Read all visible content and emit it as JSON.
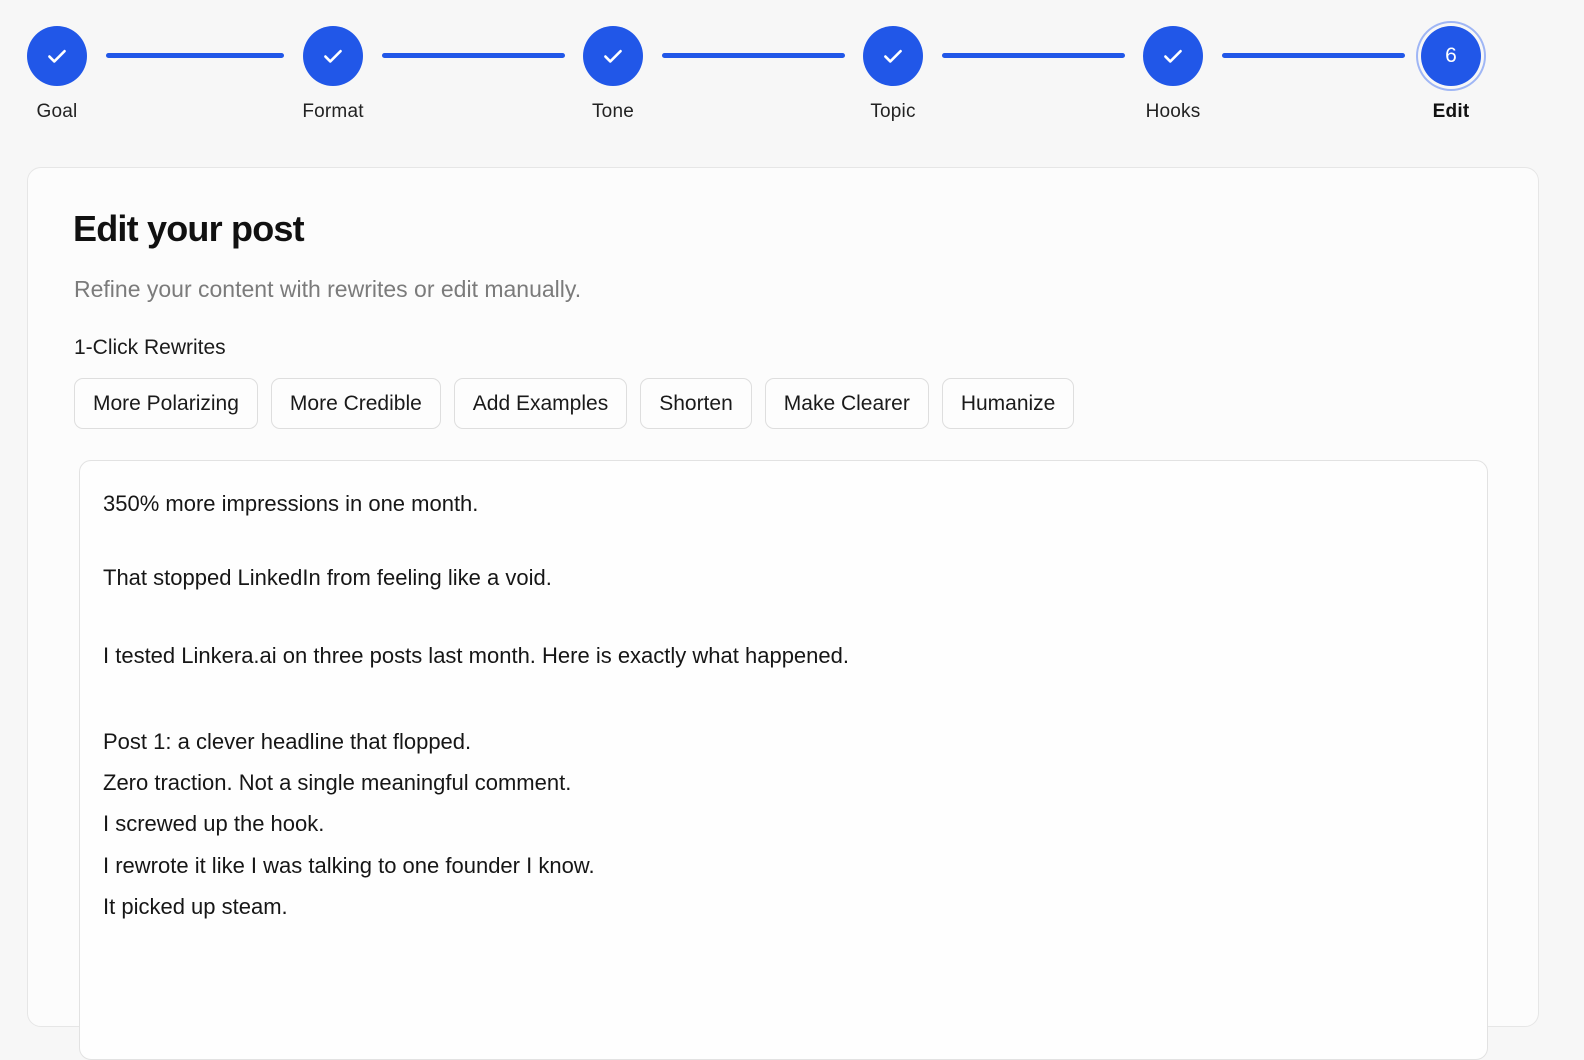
{
  "stepper": {
    "accent_color": "#2157e8",
    "steps": [
      {
        "label": "Goal",
        "state": "done"
      },
      {
        "label": "Format",
        "state": "done"
      },
      {
        "label": "Tone",
        "state": "done"
      },
      {
        "label": "Topic",
        "state": "done"
      },
      {
        "label": "Hooks",
        "state": "done"
      },
      {
        "label": "Edit",
        "state": "current",
        "number": "6"
      }
    ]
  },
  "card": {
    "title": "Edit your post",
    "subtitle": "Refine your content with rewrites or edit manually.",
    "rewrites_label": "1-Click Rewrites",
    "rewrites": [
      "More Polarizing",
      "More Credible",
      "Add Examples",
      "Shorten",
      "Make Clearer",
      "Humanize"
    ]
  },
  "editor": {
    "lines": [
      "350% more impressions in one month.",
      "That stopped LinkedIn from feeling like a void.",
      "I tested Linkera.ai on three posts last month. Here is exactly what happened.",
      "Post 1: a clever headline that flopped.",
      "Zero traction. Not a single meaningful comment.",
      "I screwed up the hook.",
      "I rewrote it like I was talking to one founder I know.",
      "It picked up steam."
    ]
  }
}
